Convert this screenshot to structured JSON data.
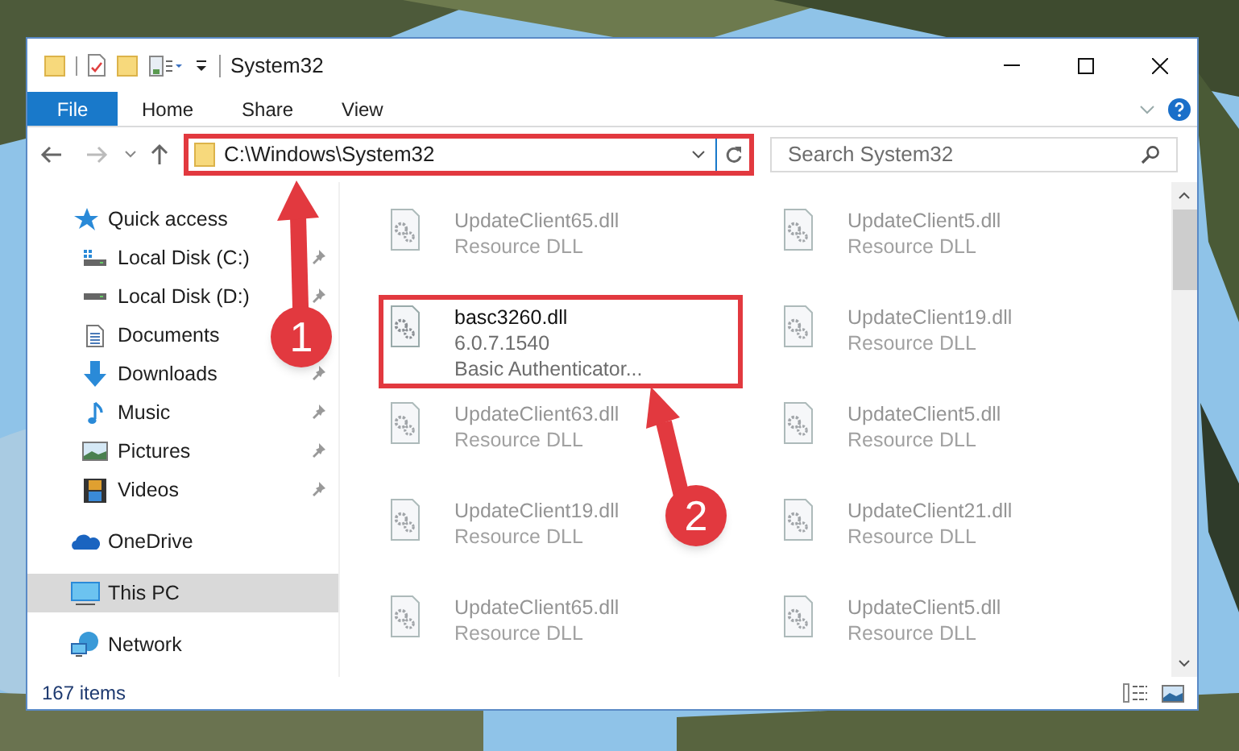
{
  "window": {
    "title": "System32"
  },
  "ribbon_tabs": [
    {
      "label": "File",
      "selected": true
    },
    {
      "label": "Home",
      "selected": false
    },
    {
      "label": "Share",
      "selected": false
    },
    {
      "label": "View",
      "selected": false
    }
  ],
  "address": {
    "path": "C:\\Windows\\System32",
    "highlighted": true
  },
  "search": {
    "placeholder": "Search System32"
  },
  "nav": [
    {
      "label": "Quick access",
      "kind": "star",
      "selected": false,
      "children": [
        {
          "label": "Local Disk (C:)",
          "kind": "disk-c",
          "selected": false,
          "pinned": true
        },
        {
          "label": "Local Disk (D:)",
          "kind": "disk",
          "selected": false,
          "pinned": true
        },
        {
          "label": "Documents",
          "kind": "document",
          "selected": false
        },
        {
          "label": "Downloads",
          "kind": "download",
          "selected": false,
          "pinned": true
        },
        {
          "label": "Music",
          "kind": "music",
          "selected": false,
          "pinned": true
        },
        {
          "label": "Pictures",
          "kind": "pictures",
          "selected": false,
          "pinned": true
        },
        {
          "label": "Videos",
          "kind": "videos",
          "selected": false,
          "pinned": true
        }
      ]
    },
    {
      "label": "OneDrive",
      "kind": "cloud",
      "selected": false
    },
    {
      "label": "This PC",
      "kind": "pc",
      "selected": true
    },
    {
      "label": "Network",
      "kind": "network",
      "selected": false
    }
  ],
  "files": [
    {
      "name": "UpdateClient65.dll",
      "details": [
        "Resource DLL"
      ],
      "blurred": true,
      "highlighted": false
    },
    {
      "name": "UpdateClient5.dll",
      "details": [
        "Resource DLL"
      ],
      "blurred": true,
      "highlighted": false
    },
    {
      "name": "basc3260.dll",
      "details": [
        "6.0.7.1540",
        "Basic Authenticator..."
      ],
      "blurred": false,
      "highlighted": true
    },
    {
      "name": "UpdateClient19.dll",
      "details": [
        "Resource DLL"
      ],
      "blurred": true,
      "highlighted": false
    },
    {
      "name": "UpdateClient63.dll",
      "details": [
        "Resource DLL"
      ],
      "blurred": true,
      "highlighted": false
    },
    {
      "name": "UpdateClient5.dll",
      "details": [
        "Resource DLL"
      ],
      "blurred": true,
      "highlighted": false
    },
    {
      "name": "UpdateClient19.dll",
      "details": [
        "Resource DLL"
      ],
      "blurred": true,
      "highlighted": false
    },
    {
      "name": "UpdateClient21.dll",
      "details": [
        "Resource DLL"
      ],
      "blurred": true,
      "highlighted": false
    },
    {
      "name": "UpdateClient65.dll",
      "details": [
        "Resource DLL"
      ],
      "blurred": true,
      "highlighted": false
    },
    {
      "name": "UpdateClient5.dll",
      "details": [
        "Resource DLL"
      ],
      "blurred": true,
      "highlighted": false
    }
  ],
  "status_bar": {
    "item_count": "167 items"
  },
  "callouts": [
    {
      "number": "1"
    },
    {
      "number": "2"
    }
  ]
}
